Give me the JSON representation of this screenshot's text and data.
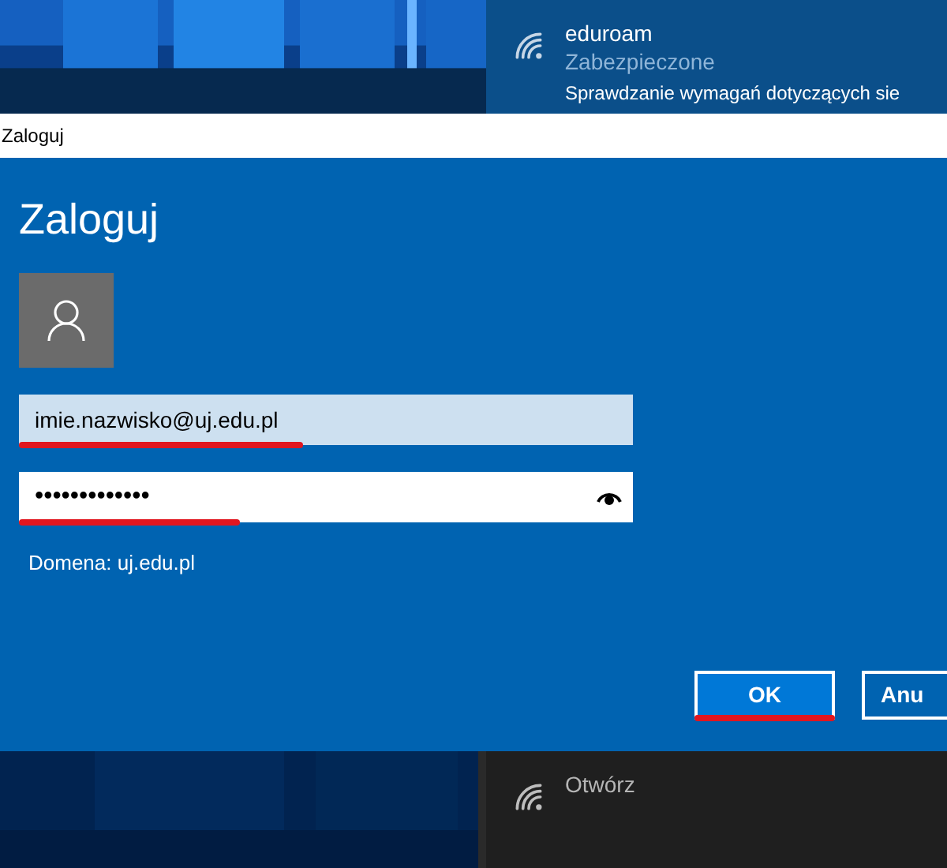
{
  "flyout": {
    "networks": [
      {
        "name": "eduroam",
        "status": "Zabezpieczone",
        "detail": "Sprawdzanie wymagań dotyczących sie",
        "selected": true
      },
      {
        "status": "Otwórz",
        "selected": false
      }
    ]
  },
  "dialog": {
    "title": "Zaloguj",
    "heading": "Zaloguj",
    "username": {
      "value": "imie.nazwisko@uj.edu.pl",
      "underlined": true
    },
    "password": {
      "value": "•••••••••••••",
      "underlined": true
    },
    "domain": "Domena: uj.edu.pl",
    "buttons": [
      {
        "label": "OK",
        "default": true,
        "underlined": true
      },
      {
        "label": "Anu",
        "default": false,
        "underlined": false
      }
    ]
  }
}
